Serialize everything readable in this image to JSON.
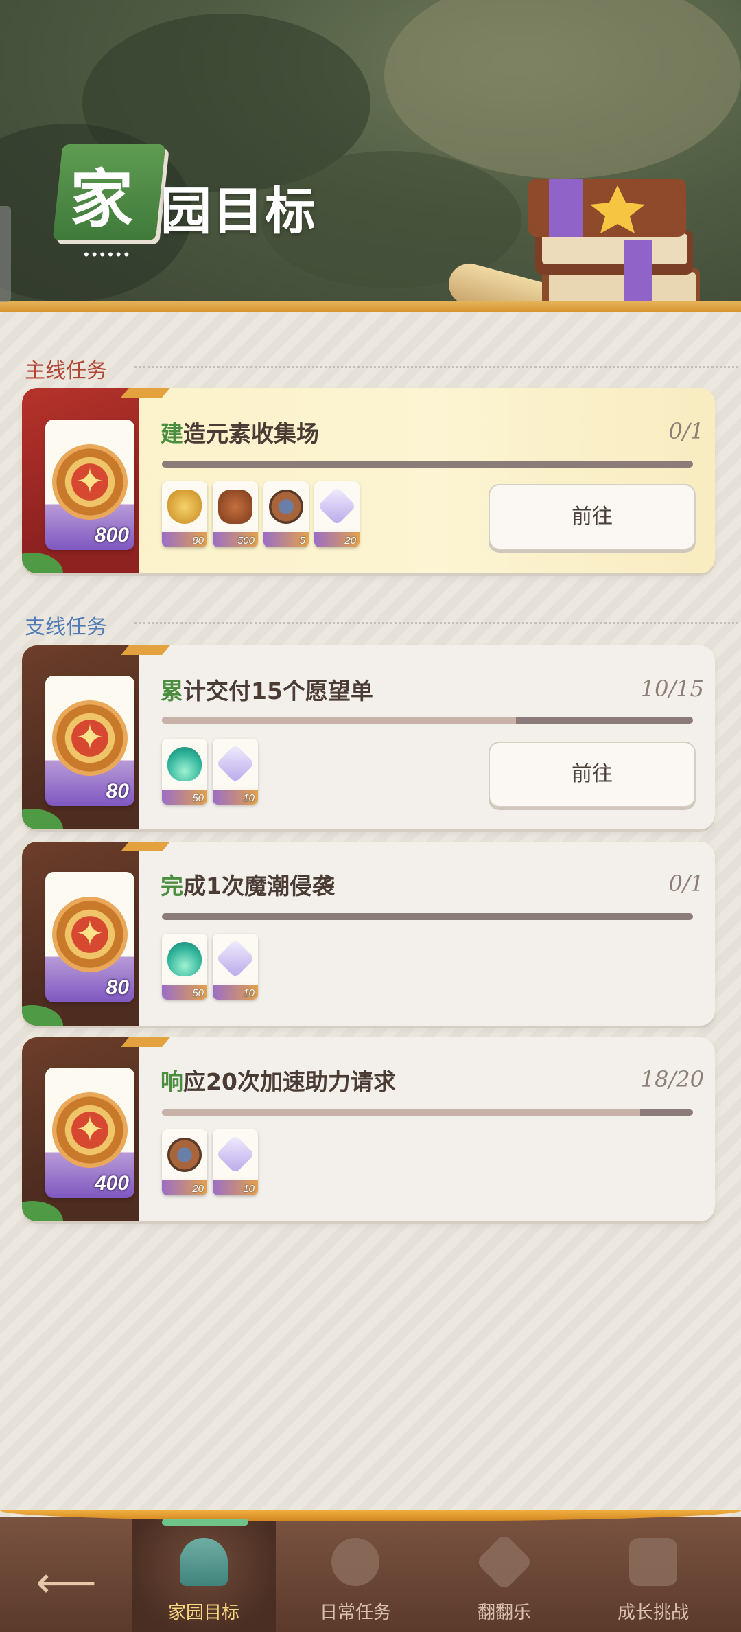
{
  "header": {
    "title_first": "家",
    "title_rest": "园目标",
    "dots": "••••••"
  },
  "main_section": {
    "label": "主线任务",
    "tasks": [
      {
        "title_prefix": "建",
        "title_rest": "造元素收集场",
        "progress": "0/1",
        "progress_fraction": 0.0,
        "reward_amount": "800",
        "items": [
          {
            "icon": "heart-icon",
            "count": "80"
          },
          {
            "icon": "wood-icon",
            "count": "500"
          },
          {
            "icon": "gear-icon",
            "count": "5"
          },
          {
            "icon": "gem-icon",
            "count": "20"
          }
        ],
        "button": "前往"
      }
    ]
  },
  "side_section": {
    "label": "支线任务",
    "tasks": [
      {
        "title_prefix": "累",
        "title_rest": "计交付15个愿望单",
        "progress": "10/15",
        "progress_fraction": 0.6667,
        "reward_amount": "80",
        "items": [
          {
            "icon": "flame-icon",
            "count": "50"
          },
          {
            "icon": "gem-icon",
            "count": "10"
          }
        ],
        "button": "前往"
      },
      {
        "title_prefix": "完",
        "title_rest": "成1次魔潮侵袭",
        "progress": "0/1",
        "progress_fraction": 0.0,
        "reward_amount": "80",
        "items": [
          {
            "icon": "flame-icon",
            "count": "50"
          },
          {
            "icon": "gem-icon",
            "count": "10"
          }
        ]
      },
      {
        "title_prefix": "响",
        "title_rest": "应20次加速助力请求",
        "progress": "18/20",
        "progress_fraction": 0.9,
        "reward_amount": "400",
        "items": [
          {
            "icon": "gear-icon",
            "count": "20"
          },
          {
            "icon": "gem-icon",
            "count": "10"
          }
        ]
      }
    ]
  },
  "nav": {
    "back_icon": "back-arrow-icon",
    "tabs": [
      {
        "label": "家园目标",
        "icon": "home-goal-icon",
        "active": true
      },
      {
        "label": "日常任务",
        "icon": "gear-icon",
        "active": false
      },
      {
        "label": "翻翻乐",
        "icon": "flip-card-icon",
        "active": false
      },
      {
        "label": "成长挑战",
        "icon": "scroll-icon",
        "active": false
      }
    ]
  },
  "colors": {
    "main_section": "#b24433",
    "side_section": "#4f7bb6",
    "highlight_char": "#4c8e40",
    "nav_active_label": "#f8d780"
  }
}
